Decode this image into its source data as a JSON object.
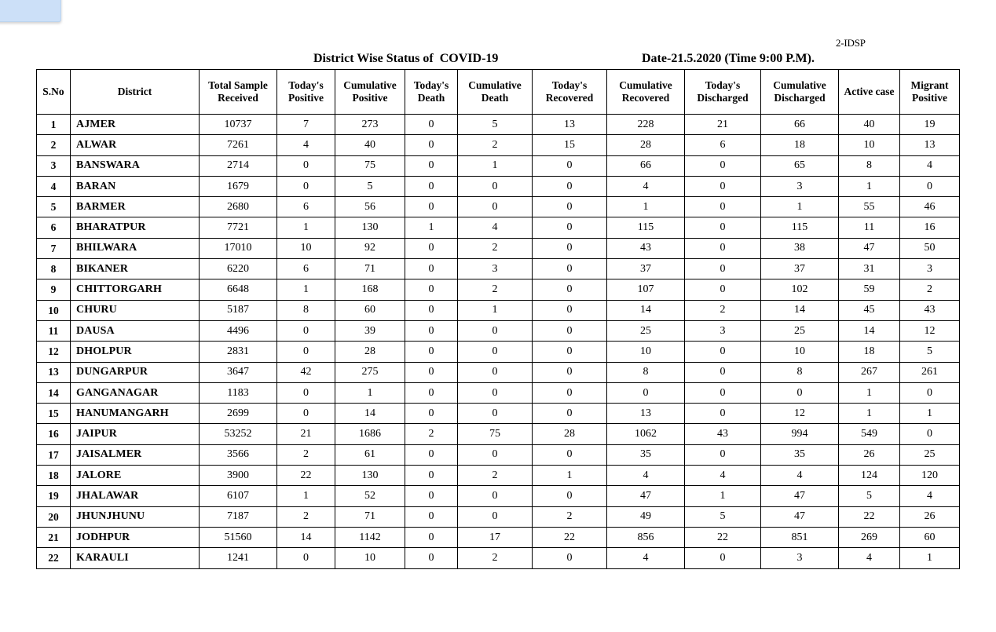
{
  "document": {
    "code": "2-IDSP",
    "title": "District Wise Status of  COVID-19",
    "date": "Date-21.5.2020 (Time 9:00 P.M)."
  },
  "table": {
    "columns": [
      {
        "key": "sno",
        "line1": "S.No",
        "line2": ""
      },
      {
        "key": "district",
        "line1": "District",
        "line2": ""
      },
      {
        "key": "sample",
        "line1": "Total Sample",
        "line2": "Received"
      },
      {
        "key": "tpos",
        "line1": "Today's",
        "line2": "Positive"
      },
      {
        "key": "cpos",
        "line1": "Cumulative",
        "line2": "Positive"
      },
      {
        "key": "tdeath",
        "line1": "Today's",
        "line2": "Death"
      },
      {
        "key": "cdeath",
        "line1": "Cumulative",
        "line2": "Death"
      },
      {
        "key": "trec",
        "line1": "Today's",
        "line2": "Recovered"
      },
      {
        "key": "crec",
        "line1": "Cumulative",
        "line2": "Recovered"
      },
      {
        "key": "tdis",
        "line1": "Today's",
        "line2": "Discharged"
      },
      {
        "key": "cdis",
        "line1": "Cumulative",
        "line2": "Discharged"
      },
      {
        "key": "active",
        "line1": "Active  case",
        "line2": ""
      },
      {
        "key": "migrant",
        "line1": "Migrant",
        "line2": "Positive"
      }
    ],
    "rows": [
      {
        "sno": "1",
        "district": "AJMER",
        "sample": "10737",
        "tpos": "7",
        "cpos": "273",
        "tdeath": "0",
        "cdeath": "5",
        "trec": "13",
        "crec": "228",
        "tdis": "21",
        "cdis": "66",
        "active": "40",
        "migrant": "19"
      },
      {
        "sno": "2",
        "district": "ALWAR",
        "sample": "7261",
        "tpos": "4",
        "cpos": "40",
        "tdeath": "0",
        "cdeath": "2",
        "trec": "15",
        "crec": "28",
        "tdis": "6",
        "cdis": "18",
        "active": "10",
        "migrant": "13"
      },
      {
        "sno": "3",
        "district": "BANSWARA",
        "sample": "2714",
        "tpos": "0",
        "cpos": "75",
        "tdeath": "0",
        "cdeath": "1",
        "trec": "0",
        "crec": "66",
        "tdis": "0",
        "cdis": "65",
        "active": "8",
        "migrant": "4"
      },
      {
        "sno": "4",
        "district": "BARAN",
        "sample": "1679",
        "tpos": "0",
        "cpos": "5",
        "tdeath": "0",
        "cdeath": "0",
        "trec": "0",
        "crec": "4",
        "tdis": "0",
        "cdis": "3",
        "active": "1",
        "migrant": "0"
      },
      {
        "sno": "5",
        "district": "BARMER",
        "sample": "2680",
        "tpos": "6",
        "cpos": "56",
        "tdeath": "0",
        "cdeath": "0",
        "trec": "0",
        "crec": "1",
        "tdis": "0",
        "cdis": "1",
        "active": "55",
        "migrant": "46"
      },
      {
        "sno": "6",
        "district": "BHARATPUR",
        "sample": "7721",
        "tpos": "1",
        "cpos": "130",
        "tdeath": "1",
        "cdeath": "4",
        "trec": "0",
        "crec": "115",
        "tdis": "0",
        "cdis": "115",
        "active": "11",
        "migrant": "16"
      },
      {
        "sno": "7",
        "district": "BHILWARA",
        "sample": "17010",
        "tpos": "10",
        "cpos": "92",
        "tdeath": "0",
        "cdeath": "2",
        "trec": "0",
        "crec": "43",
        "tdis": "0",
        "cdis": "38",
        "active": "47",
        "migrant": "50"
      },
      {
        "sno": "8",
        "district": "BIKANER",
        "sample": "6220",
        "tpos": "6",
        "cpos": "71",
        "tdeath": "0",
        "cdeath": "3",
        "trec": "0",
        "crec": "37",
        "tdis": "0",
        "cdis": "37",
        "active": "31",
        "migrant": "3"
      },
      {
        "sno": "9",
        "district": "CHITTORGARH",
        "sample": "6648",
        "tpos": "1",
        "cpos": "168",
        "tdeath": "0",
        "cdeath": "2",
        "trec": "0",
        "crec": "107",
        "tdis": "0",
        "cdis": "102",
        "active": "59",
        "migrant": "2"
      },
      {
        "sno": "10",
        "district": "CHURU",
        "sample": "5187",
        "tpos": "8",
        "cpos": "60",
        "tdeath": "0",
        "cdeath": "1",
        "trec": "0",
        "crec": "14",
        "tdis": "2",
        "cdis": "14",
        "active": "45",
        "migrant": "43"
      },
      {
        "sno": "11",
        "district": "DAUSA",
        "sample": "4496",
        "tpos": "0",
        "cpos": "39",
        "tdeath": "0",
        "cdeath": "0",
        "trec": "0",
        "crec": "25",
        "tdis": "3",
        "cdis": "25",
        "active": "14",
        "migrant": "12"
      },
      {
        "sno": "12",
        "district": "DHOLPUR",
        "sample": "2831",
        "tpos": "0",
        "cpos": "28",
        "tdeath": "0",
        "cdeath": "0",
        "trec": "0",
        "crec": "10",
        "tdis": "0",
        "cdis": "10",
        "active": "18",
        "migrant": "5"
      },
      {
        "sno": "13",
        "district": "DUNGARPUR",
        "sample": "3647",
        "tpos": "42",
        "cpos": "275",
        "tdeath": "0",
        "cdeath": "0",
        "trec": "0",
        "crec": "8",
        "tdis": "0",
        "cdis": "8",
        "active": "267",
        "migrant": "261"
      },
      {
        "sno": "14",
        "district": "GANGANAGAR",
        "sample": "1183",
        "tpos": "0",
        "cpos": "1",
        "tdeath": "0",
        "cdeath": "0",
        "trec": "0",
        "crec": "0",
        "tdis": "0",
        "cdis": "0",
        "active": "1",
        "migrant": "0"
      },
      {
        "sno": "15",
        "district": "HANUMANGARH",
        "sample": "2699",
        "tpos": "0",
        "cpos": "14",
        "tdeath": "0",
        "cdeath": "0",
        "trec": "0",
        "crec": "13",
        "tdis": "0",
        "cdis": "12",
        "active": "1",
        "migrant": "1"
      },
      {
        "sno": "16",
        "district": "JAIPUR",
        "sample": "53252",
        "tpos": "21",
        "cpos": "1686",
        "tdeath": "2",
        "cdeath": "75",
        "trec": "28",
        "crec": "1062",
        "tdis": "43",
        "cdis": "994",
        "active": "549",
        "migrant": "0"
      },
      {
        "sno": "17",
        "district": "JAISALMER",
        "sample": "3566",
        "tpos": "2",
        "cpos": "61",
        "tdeath": "0",
        "cdeath": "0",
        "trec": "0",
        "crec": "35",
        "tdis": "0",
        "cdis": "35",
        "active": "26",
        "migrant": "25"
      },
      {
        "sno": "18",
        "district": "JALORE",
        "sample": "3900",
        "tpos": "22",
        "cpos": "130",
        "tdeath": "0",
        "cdeath": "2",
        "trec": "1",
        "crec": "4",
        "tdis": "4",
        "cdis": "4",
        "active": "124",
        "migrant": "120"
      },
      {
        "sno": "19",
        "district": "JHALAWAR",
        "sample": "6107",
        "tpos": "1",
        "cpos": "52",
        "tdeath": "0",
        "cdeath": "0",
        "trec": "0",
        "crec": "47",
        "tdis": "1",
        "cdis": "47",
        "active": "5",
        "migrant": "4"
      },
      {
        "sno": "20",
        "district": "JHUNJHUNU",
        "sample": "7187",
        "tpos": "2",
        "cpos": "71",
        "tdeath": "0",
        "cdeath": "0",
        "trec": "2",
        "crec": "49",
        "tdis": "5",
        "cdis": "47",
        "active": "22",
        "migrant": "26"
      },
      {
        "sno": "21",
        "district": "JODHPUR",
        "sample": "51560",
        "tpos": "14",
        "cpos": "1142",
        "tdeath": "0",
        "cdeath": "17",
        "trec": "22",
        "crec": "856",
        "tdis": "22",
        "cdis": "851",
        "active": "269",
        "migrant": "60"
      },
      {
        "sno": "22",
        "district": "KARAULI",
        "sample": "1241",
        "tpos": "0",
        "cpos": "10",
        "tdeath": "0",
        "cdeath": "2",
        "trec": "0",
        "crec": "4",
        "tdis": "0",
        "cdis": "3",
        "active": "4",
        "migrant": "1"
      }
    ]
  },
  "colors": {
    "panel_blue": "#cce0f8",
    "border": "#000000",
    "text": "#000000",
    "background": "#ffffff"
  }
}
